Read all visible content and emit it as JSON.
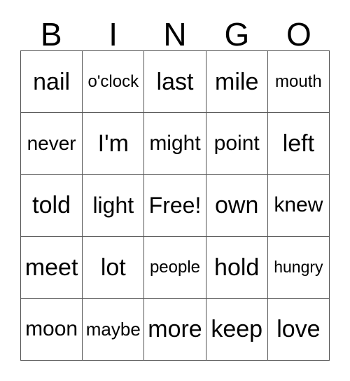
{
  "card": {
    "title": "BINGO",
    "header_letters": [
      "B",
      "I",
      "N",
      "G",
      "O"
    ],
    "free_space_label": "Free!",
    "colors": {
      "background": "#ffffff",
      "text": "#000000",
      "grid_line": "#555555"
    },
    "rows": [
      [
        {
          "text": "nail",
          "size": "fs-xl"
        },
        {
          "text": "o'clock",
          "size": "fs-s"
        },
        {
          "text": "last",
          "size": "fs-xl"
        },
        {
          "text": "mile",
          "size": "fs-xl"
        },
        {
          "text": "mouth",
          "size": "fs-s"
        }
      ],
      [
        {
          "text": "never",
          "size": "fs-m"
        },
        {
          "text": "I'm",
          "size": "fs-xl"
        },
        {
          "text": "might",
          "size": "fs-ml"
        },
        {
          "text": "point",
          "size": "fs-ml"
        },
        {
          "text": "left",
          "size": "fs-xl"
        }
      ],
      [
        {
          "text": "told",
          "size": "fs-xl"
        },
        {
          "text": "light",
          "size": "fs-l"
        },
        {
          "text": "Free!",
          "size": "fs-l"
        },
        {
          "text": "own",
          "size": "fs-xl"
        },
        {
          "text": "knew",
          "size": "fs-ml"
        }
      ],
      [
        {
          "text": "meet",
          "size": "fs-xl"
        },
        {
          "text": "lot",
          "size": "fs-xl"
        },
        {
          "text": "people",
          "size": "fs-s"
        },
        {
          "text": "hold",
          "size": "fs-xl"
        },
        {
          "text": "hungry",
          "size": "fs-xs"
        }
      ],
      [
        {
          "text": "moon",
          "size": "fs-ml"
        },
        {
          "text": "maybe",
          "size": "fs-sm"
        },
        {
          "text": "more",
          "size": "fs-xl"
        },
        {
          "text": "keep",
          "size": "fs-xl"
        },
        {
          "text": "love",
          "size": "fs-xl"
        }
      ]
    ]
  }
}
